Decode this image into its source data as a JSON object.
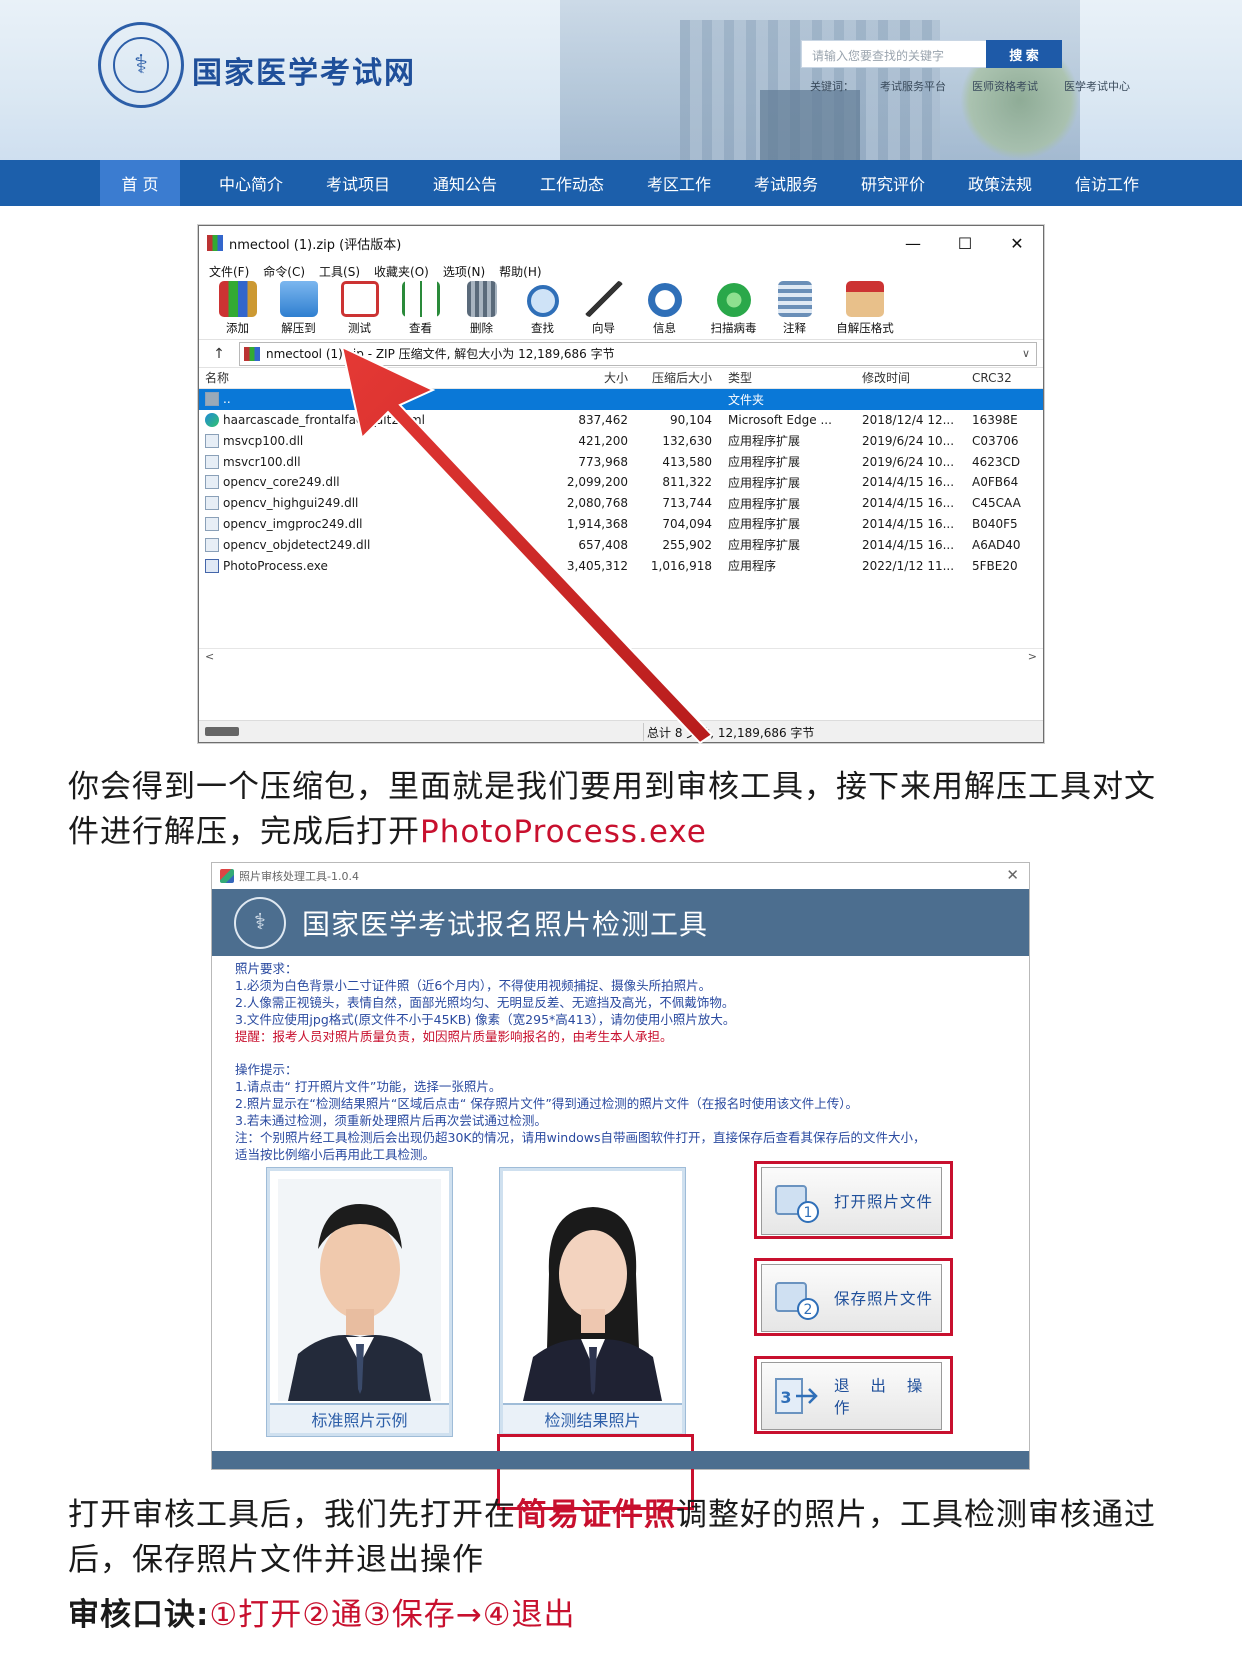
{
  "header": {
    "site_name": "国家医学考试网",
    "search_placeholder": "请输入您要查找的关键字",
    "search_button": "搜 索",
    "keywords_label": "关键词：",
    "keywords": [
      "考试服务平台",
      "医师资格考试",
      "医学考试中心"
    ]
  },
  "nav": {
    "items": [
      "首 页",
      "中心简介",
      "考试项目",
      "通知公告",
      "工作动态",
      "考区工作",
      "考试服务",
      "研究评价",
      "政策法规",
      "信访工作"
    ],
    "active_index": 0
  },
  "winrar": {
    "title": "nmectool (1).zip (评估版本)",
    "menu": [
      "文件(F)",
      "命令(C)",
      "工具(S)",
      "收藏夹(O)",
      "选项(N)",
      "帮助(H)"
    ],
    "toolbar": [
      "添加",
      "解压到",
      "测试",
      "查看",
      "删除",
      "查找",
      "向导",
      "信息",
      "扫描病毒",
      "注释",
      "自解压格式"
    ],
    "path": "nmectool (1).zip - ZIP 压缩文件, 解包大小为 12,189,686 字节",
    "columns": [
      "名称",
      "大小",
      "压缩后大小",
      "类型",
      "修改时间",
      "CRC32"
    ],
    "rows": [
      {
        "name": "..",
        "size": "",
        "packed": "",
        "type": "文件夹",
        "mtime": "",
        "crc": "",
        "icon": "up"
      },
      {
        "name": "haarcascade_frontalface_alt2.xml",
        "size": "837,462",
        "packed": "90,104",
        "type": "Microsoft Edge ...",
        "mtime": "2018/12/4 12...",
        "crc": "16398E",
        "icon": "edge"
      },
      {
        "name": "msvcp100.dll",
        "size": "421,200",
        "packed": "132,630",
        "type": "应用程序扩展",
        "mtime": "2019/6/24 10...",
        "crc": "C03706",
        "icon": "dll"
      },
      {
        "name": "msvcr100.dll",
        "size": "773,968",
        "packed": "413,580",
        "type": "应用程序扩展",
        "mtime": "2019/6/24 10...",
        "crc": "4623CD",
        "icon": "dll"
      },
      {
        "name": "opencv_core249.dll",
        "size": "2,099,200",
        "packed": "811,322",
        "type": "应用程序扩展",
        "mtime": "2014/4/15 16...",
        "crc": "A0FB64",
        "icon": "dll"
      },
      {
        "name": "opencv_highgui249.dll",
        "size": "2,080,768",
        "packed": "713,744",
        "type": "应用程序扩展",
        "mtime": "2014/4/15 16...",
        "crc": "C45CAA",
        "icon": "dll"
      },
      {
        "name": "opencv_imgproc249.dll",
        "size": "1,914,368",
        "packed": "704,094",
        "type": "应用程序扩展",
        "mtime": "2014/4/15 16...",
        "crc": "B040F5",
        "icon": "dll"
      },
      {
        "name": "opencv_objdetect249.dll",
        "size": "657,408",
        "packed": "255,902",
        "type": "应用程序扩展",
        "mtime": "2014/4/15 16...",
        "crc": "A6AD40",
        "icon": "dll"
      },
      {
        "name": "PhotoProcess.exe",
        "size": "3,405,312",
        "packed": "1,016,918",
        "type": "应用程序",
        "mtime": "2022/1/12 11...",
        "crc": "5FBE20",
        "icon": "exe"
      }
    ],
    "status": "总计 8 文件, 12,189,686 字节"
  },
  "para1": {
    "text": "你会得到一个压缩包，里面就是我们要用到审核工具，接下来用解压工具对文件进行解压，完成后打开",
    "highlight": "PhotoProcess.exe"
  },
  "tool": {
    "window_title": "照片审核处理工具-1.0.4",
    "banner_title": "国家医学考试报名照片检测工具",
    "req_title": "照片要求：",
    "req_lines": [
      "1.必须为白色背景小二寸证件照（近6个月内），不得使用视频捕捉、摄像头所拍照片。",
      "2.人像需正视镜头，表情自然，面部光照均匀、无明显反差、无遮挡及高光，不佩戴饰物。",
      "3.文件应使用jpg格式(原文件不小于45KB) 像素（宽295*高413），请勿使用小照片放大。"
    ],
    "warning": "提醒：报考人员对照片质量负责，如因照片质量影响报名的，由考生本人承担。",
    "ops_title": "操作提示：",
    "ops_lines": [
      "1.请点击“ 打开照片文件”功能，选择一张照片。",
      "2.照片显示在“检测结果照片“区域后点击“ 保存照片文件”得到通过检测的照片文件（在报名时使用该文件上传）。",
      "3.若未通过检测，须重新处理照片后再次尝试通过检测。",
      "注：个别照片经工具检测后会出现仍超30K的情况，请用windows自带画图软件打开，直接保存后查看其保存后的文件大小，",
      "适当按比例缩小后再用此工具检测。"
    ],
    "sample_caption": "标准照片示例",
    "result_caption": "检测结果照片",
    "buttons": [
      "打开照片文件",
      "保存照片文件",
      "退 出 操 作"
    ],
    "button_numbers": [
      "1",
      "2",
      "3"
    ]
  },
  "para2": {
    "before": "打开审核工具后，我们先打开在",
    "highlight": "简易证件照",
    "after": "调整好的照片，工具检测审核通过后，保存照片文件并退出操作"
  },
  "mnemonic": {
    "label": "审核口诀:",
    "text": "①打开②通③保存→④退出"
  },
  "colors": {
    "nav_blue": "#1c5fab",
    "highlight_red": "#c8102e",
    "tool_banner": "#4c6e8f"
  }
}
